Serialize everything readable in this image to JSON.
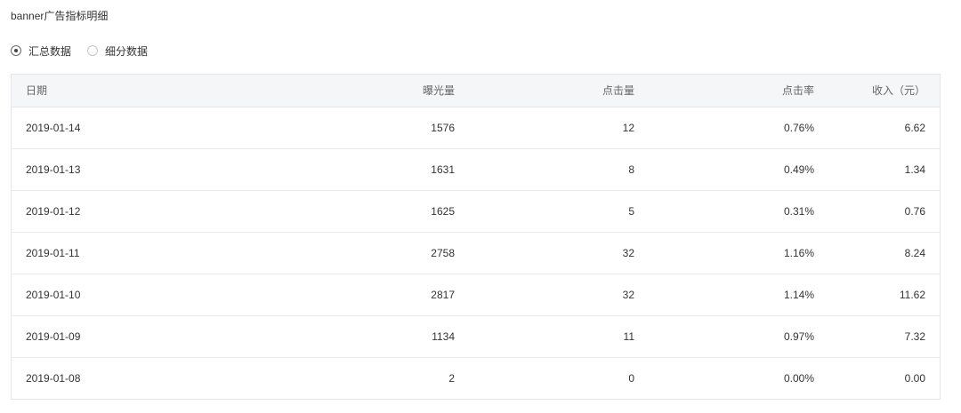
{
  "page": {
    "title": "banner广告指标明细"
  },
  "view_mode": {
    "options": [
      {
        "label": "汇总数据",
        "checked": true
      },
      {
        "label": "细分数据",
        "checked": false
      }
    ]
  },
  "table": {
    "columns": [
      "日期",
      "曝光量",
      "点击量",
      "点击率",
      "收入（元）"
    ],
    "rows": [
      {
        "date": "2019-01-14",
        "exposure": "1576",
        "clicks": "12",
        "ctr": "0.76%",
        "revenue": "6.62"
      },
      {
        "date": "2019-01-13",
        "exposure": "1631",
        "clicks": "8",
        "ctr": "0.49%",
        "revenue": "1.34"
      },
      {
        "date": "2019-01-12",
        "exposure": "1625",
        "clicks": "5",
        "ctr": "0.31%",
        "revenue": "0.76"
      },
      {
        "date": "2019-01-11",
        "exposure": "2758",
        "clicks": "32",
        "ctr": "1.16%",
        "revenue": "8.24"
      },
      {
        "date": "2019-01-10",
        "exposure": "2817",
        "clicks": "32",
        "ctr": "1.14%",
        "revenue": "11.62"
      },
      {
        "date": "2019-01-09",
        "exposure": "1134",
        "clicks": "11",
        "ctr": "0.97%",
        "revenue": "7.32"
      },
      {
        "date": "2019-01-08",
        "exposure": "2",
        "clicks": "0",
        "ctr": "0.00%",
        "revenue": "0.00"
      }
    ]
  }
}
